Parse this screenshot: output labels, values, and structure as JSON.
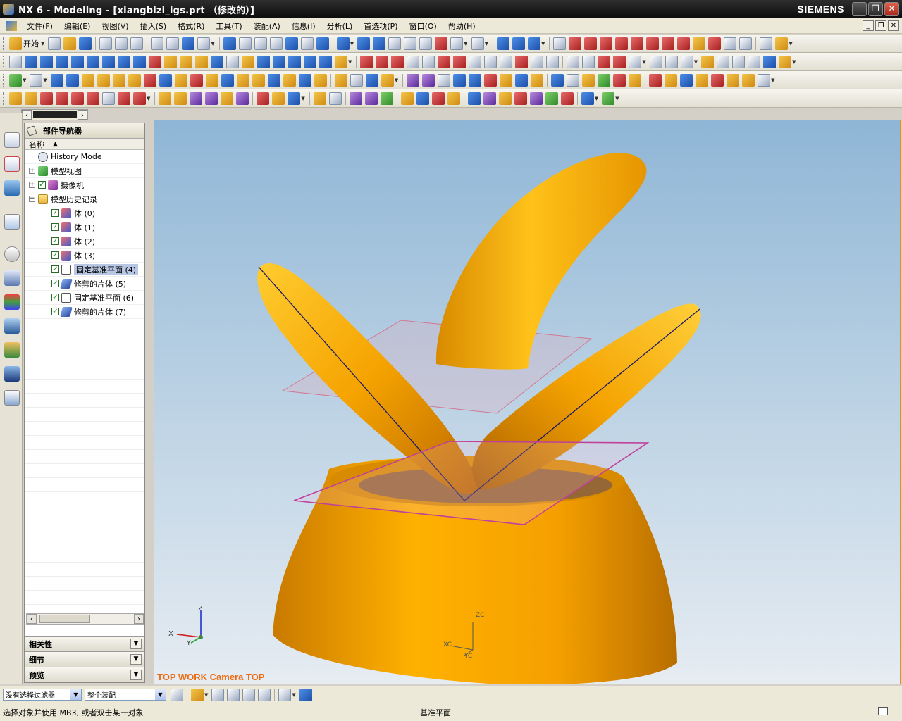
{
  "window": {
    "title": "NX 6 - Modeling - [xiangbizi_igs.prt （修改的）]",
    "brand": "SIEMENS",
    "buttons": {
      "minimize": "_",
      "maximize": "❐",
      "close": "✕"
    }
  },
  "menu": {
    "items": [
      "文件(F)",
      "编辑(E)",
      "视图(V)",
      "插入(S)",
      "格式(R)",
      "工具(T)",
      "装配(A)",
      "信息(I)",
      "分析(L)",
      "首选项(P)",
      "窗口(O)",
      "帮助(H)"
    ]
  },
  "toolbar": {
    "start_label": "开始"
  },
  "navigator": {
    "title": "部件导航器",
    "column_name": "名称",
    "rows": [
      {
        "label": "History Mode",
        "icon": "clock-icon"
      },
      {
        "label": "模型视图",
        "icon": "model-views-icon"
      },
      {
        "label": "摄像机",
        "icon": "camera-icon"
      },
      {
        "label": "模型历史记录",
        "icon": "folder-icon"
      },
      {
        "label": "体 (0)",
        "icon": "body-icon",
        "checked": true
      },
      {
        "label": "体 (1)",
        "icon": "body-icon",
        "checked": true
      },
      {
        "label": "体 (2)",
        "icon": "body-icon",
        "checked": true
      },
      {
        "label": "体 (3)",
        "icon": "body-icon",
        "checked": true
      },
      {
        "label": "固定基准平面 (4)",
        "icon": "datum-plane-icon",
        "checked": true,
        "selected": true
      },
      {
        "label": "修剪的片体 (5)",
        "icon": "trimmed-sheet-icon",
        "checked": true
      },
      {
        "label": "固定基准平面 (6)",
        "icon": "datum-plane-icon",
        "checked": true
      },
      {
        "label": "修剪的片体 (7)",
        "icon": "trimmed-sheet-icon",
        "checked": true
      }
    ],
    "panels": [
      "相关性",
      "细节",
      "预览"
    ]
  },
  "viewport": {
    "view_label": "TOP WORK Camera TOP",
    "triad_labels": {
      "z": "Z",
      "x": "X",
      "y": "Y",
      "zc": "ZC",
      "xc": "XC",
      "yc": "YC"
    },
    "model_color": "#f5a300",
    "plane_color": "#c0409a"
  },
  "selection_bar": {
    "filter": "没有选择过滤器",
    "scope": "整个装配"
  },
  "status": {
    "prompt": "选择对象并使用 MB3, 或者双击某一对象",
    "selection": "基准平面"
  }
}
